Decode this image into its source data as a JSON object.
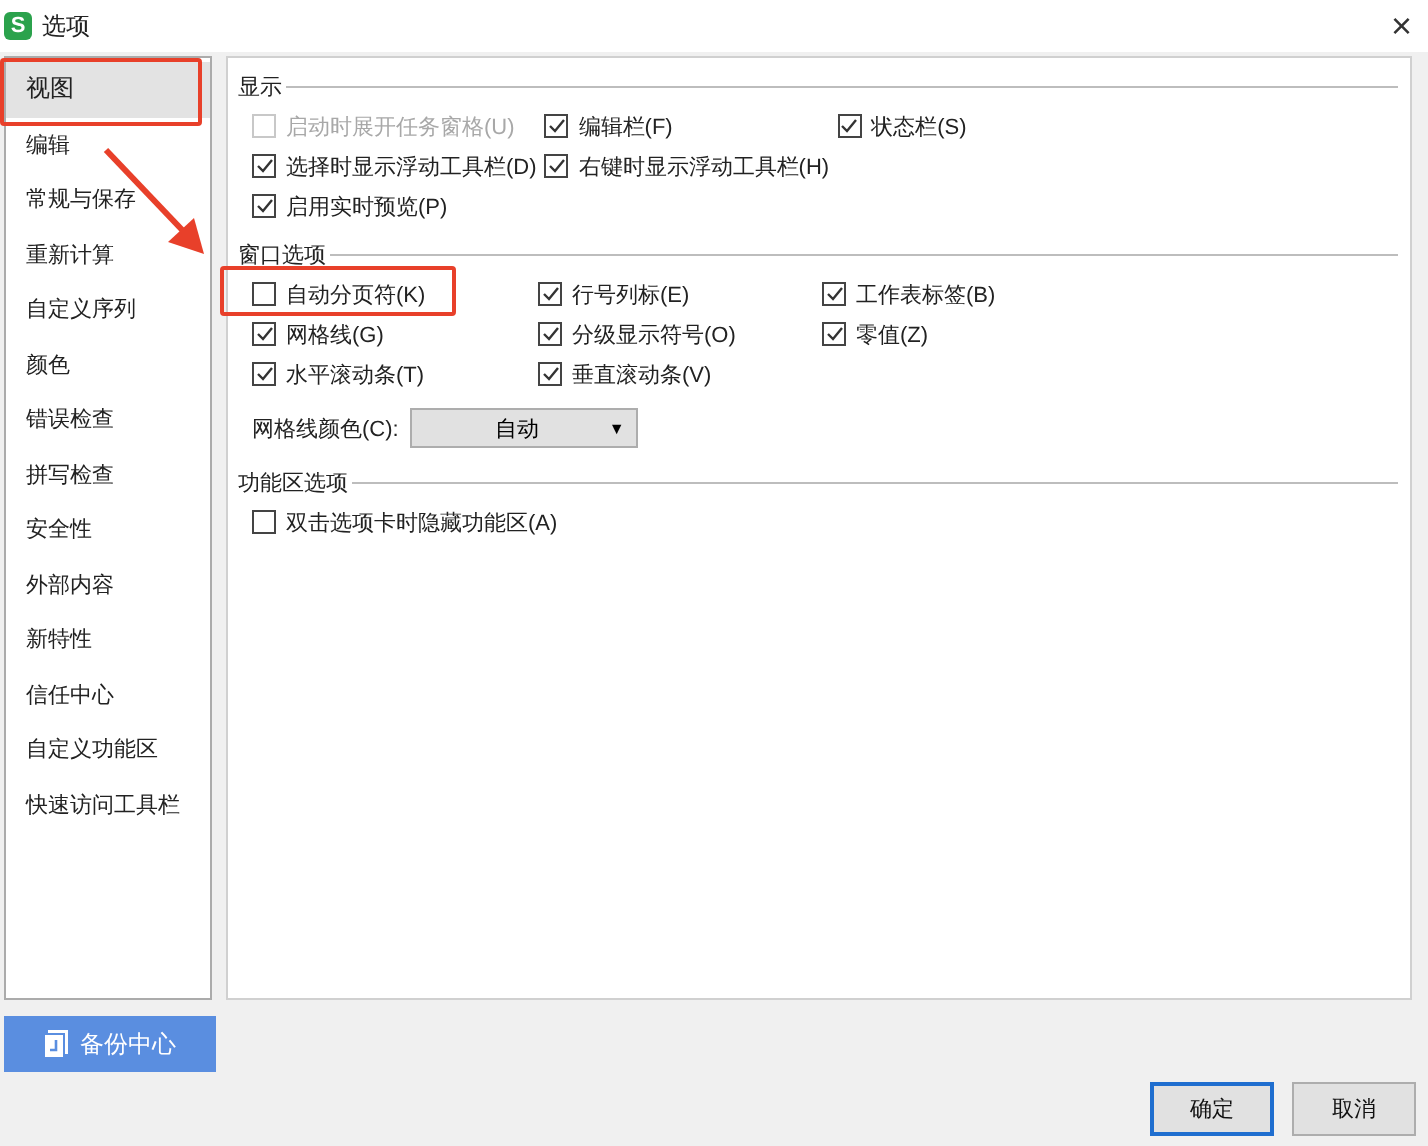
{
  "window": {
    "icon_letter": "S",
    "title": "选项",
    "close": "×"
  },
  "sidebar": {
    "items": [
      {
        "label": "视图",
        "selected": true
      },
      {
        "label": "编辑",
        "selected": false
      },
      {
        "label": "常规与保存",
        "selected": false
      },
      {
        "label": "重新计算",
        "selected": false
      },
      {
        "label": "自定义序列",
        "selected": false
      },
      {
        "label": "颜色",
        "selected": false
      },
      {
        "label": "错误检查",
        "selected": false
      },
      {
        "label": "拼写检查",
        "selected": false
      },
      {
        "label": "安全性",
        "selected": false
      },
      {
        "label": "外部内容",
        "selected": false
      },
      {
        "label": "新特性",
        "selected": false
      },
      {
        "label": "信任中心",
        "selected": false
      },
      {
        "label": "自定义功能区",
        "selected": false
      },
      {
        "label": "快速访问工具栏",
        "selected": false
      }
    ]
  },
  "sections": [
    {
      "title": "显示",
      "rows": [
        [
          {
            "label": "启动时展开任务窗格(U)",
            "checked": false,
            "disabled": true
          },
          {
            "label": "编辑栏(F)",
            "checked": true,
            "disabled": false
          },
          {
            "label": "状态栏(S)",
            "checked": true,
            "disabled": false
          }
        ],
        [
          {
            "label": "选择时显示浮动工具栏(D)",
            "checked": true,
            "disabled": false
          },
          {
            "label": "右键时显示浮动工具栏(H)",
            "checked": true,
            "disabled": false
          }
        ],
        [
          {
            "label": "启用实时预览(P)",
            "checked": true,
            "disabled": false
          }
        ]
      ]
    },
    {
      "title": "窗口选项",
      "rows": [
        [
          {
            "label": "自动分页符(K)",
            "checked": false,
            "disabled": false
          },
          {
            "label": "行号列标(E)",
            "checked": true,
            "disabled": false
          },
          {
            "label": "工作表标签(B)",
            "checked": true,
            "disabled": false
          }
        ],
        [
          {
            "label": "网格线(G)",
            "checked": true,
            "disabled": false
          },
          {
            "label": "分级显示符号(O)",
            "checked": true,
            "disabled": false
          },
          {
            "label": "零值(Z)",
            "checked": true,
            "disabled": false
          }
        ],
        [
          {
            "label": "水平滚动条(T)",
            "checked": true,
            "disabled": false
          },
          {
            "label": "垂直滚动条(V)",
            "checked": true,
            "disabled": false
          }
        ]
      ],
      "dropdown": {
        "label": "网格线颜色(C):",
        "value": "自动",
        "arrow": "▼"
      }
    },
    {
      "title": "功能区选项",
      "rows": [
        [
          {
            "label": "双击选项卡时隐藏功能区(A)",
            "checked": false,
            "disabled": false
          }
        ]
      ]
    }
  ],
  "backup_button": {
    "label": "备份中心"
  },
  "buttons": [
    {
      "label": "确定",
      "kind": "primary"
    },
    {
      "label": "取消",
      "kind": "normal"
    }
  ]
}
